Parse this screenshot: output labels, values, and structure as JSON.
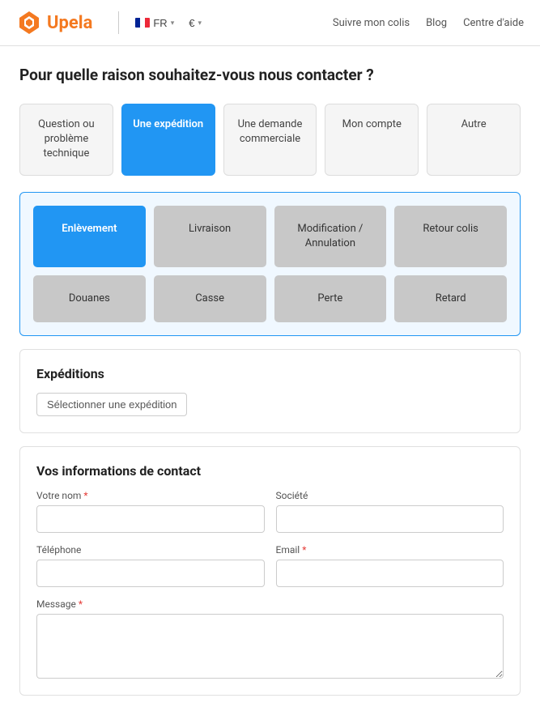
{
  "header": {
    "logo_text": "Upela",
    "lang_label": "FR",
    "currency_label": "€",
    "nav": {
      "track": "Suivre mon colis",
      "blog": "Blog",
      "help": "Centre d'aide"
    }
  },
  "page": {
    "title": "Pour quelle raison souhaitez-vous nous contacter ?"
  },
  "categories": [
    {
      "id": "tech",
      "label": "Question ou problème technique",
      "active": false
    },
    {
      "id": "expedition",
      "label": "Une expédition",
      "active": true
    },
    {
      "id": "demande",
      "label": "Une demande commerciale",
      "active": false
    },
    {
      "id": "compte",
      "label": "Mon compte",
      "active": false
    },
    {
      "id": "autre",
      "label": "Autre",
      "active": false
    }
  ],
  "subcategories": [
    {
      "id": "enlevement",
      "label": "Enlèvement",
      "active": true
    },
    {
      "id": "livraison",
      "label": "Livraison",
      "active": false
    },
    {
      "id": "modification",
      "label": "Modification / Annulation",
      "active": false
    },
    {
      "id": "retour",
      "label": "Retour colis",
      "active": false
    },
    {
      "id": "douanes",
      "label": "Douanes",
      "active": false
    },
    {
      "id": "casse",
      "label": "Casse",
      "active": false
    },
    {
      "id": "perte",
      "label": "Perte",
      "active": false
    },
    {
      "id": "retard",
      "label": "Retard",
      "active": false
    }
  ],
  "expeditions_section": {
    "title": "Expéditions",
    "select_btn_label": "Sélectionner une expédition"
  },
  "contact_form": {
    "title": "Vos informations de contact",
    "fields": {
      "nom_label": "Votre nom",
      "nom_placeholder": "",
      "societe_label": "Société",
      "societe_placeholder": "",
      "telephone_label": "Téléphone",
      "telephone_placeholder": "",
      "email_label": "Email",
      "email_placeholder": "",
      "message_label": "Message"
    }
  }
}
